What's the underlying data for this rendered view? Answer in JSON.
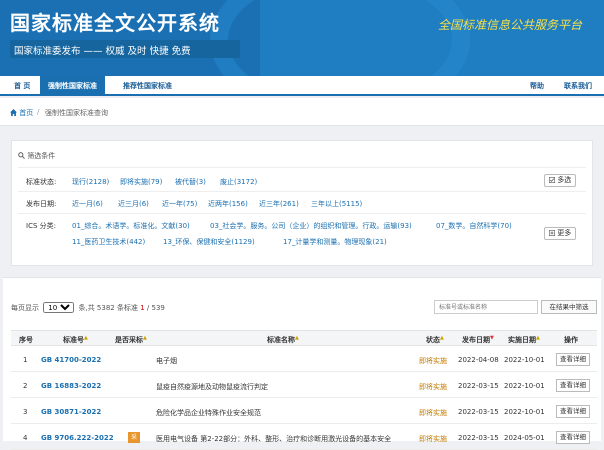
{
  "header": {
    "title": "国家标准全文公开系统",
    "subtitle": "国家标准委发布  ——  权威  及时  快捷  免费",
    "slogan": "全国标准信息公共服务平台"
  },
  "nav": {
    "home": "首 页",
    "mandatory": "强制性国家标准",
    "recommended": "推荐性国家标准",
    "help": "帮助",
    "contact": "联系我们"
  },
  "breadcrumb": {
    "home": "首页",
    "separator": "/",
    "current": "强制性国家标准查询"
  },
  "filter": {
    "title": "筛选条件",
    "status_label": "标准状态:",
    "status_options": [
      "现行(2128)",
      "即将实施(79)",
      "被代替(3)",
      "废止(3172)"
    ],
    "date_label": "发布日期:",
    "date_options": [
      "近一月(6)",
      "近三月(6)",
      "近一年(75)",
      "近两年(156)",
      "近三年(261)",
      "三年以上(5115)"
    ],
    "ics_label": "ICS 分类:",
    "ics_options": [
      "01_综合。术语学。标准化。文献(30)",
      "03_社会学。服务。公司（企业）的组织和管理。行政。运输(93)",
      "07_数学。自然科学(70)",
      "11_医药卫生技术(442)",
      "13_环保、保健和安全(1129)",
      "17_计量学和测量。物理现象(21)"
    ],
    "multi_btn": "多选",
    "more_btn": "更多"
  },
  "results": {
    "pager_prefix": "每页显示",
    "page_size": "10",
    "pager_mid": "条,共 5382 条标准",
    "page_current": "1",
    "page_sep": "/ 539",
    "search_placeholder": "标准号或标准名称",
    "search_btn": "在结果中筛选",
    "columns": {
      "no": "序号",
      "code": "标准号",
      "adopt": "是否采标",
      "name": "标准名称",
      "status": "状态",
      "pub": "发布日期",
      "impl": "实施日期",
      "op": "操作"
    },
    "rows": [
      {
        "no": "1",
        "code": "GB 41700-2022",
        "adopt": "",
        "name": "电子烟",
        "status": "即将实施",
        "pub": "2022-04-08",
        "impl": "2022-10-01",
        "op": "查看详细"
      },
      {
        "no": "2",
        "code": "GB 16883-2022",
        "adopt": "",
        "name": "鼠疫自然疫源地及动物鼠疫流行判定",
        "status": "即将实施",
        "pub": "2022-03-15",
        "impl": "2022-10-01",
        "op": "查看详细"
      },
      {
        "no": "3",
        "code": "GB 30871-2022",
        "adopt": "",
        "name": "危险化学品企业特殊作业安全规范",
        "status": "即将实施",
        "pub": "2022-03-15",
        "impl": "2022-10-01",
        "op": "查看详细"
      },
      {
        "no": "4",
        "code": "GB 9706.222-2022",
        "adopt": "采",
        "name": "医用电气设备 第2-22部分：外科、整形、治疗和诊断用激光设备的基本安全",
        "status": "即将实施",
        "pub": "2022-03-15",
        "impl": "2024-05-01",
        "op": "查看详细"
      }
    ]
  }
}
